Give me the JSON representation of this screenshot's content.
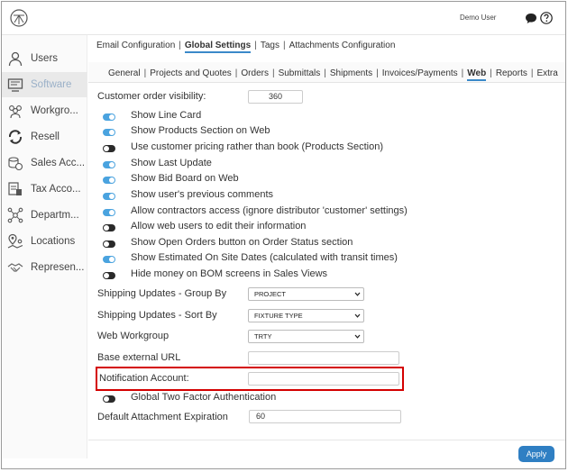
{
  "header": {
    "user_name": "Demo User"
  },
  "sidebar": {
    "items": [
      {
        "label": "Users",
        "icon": "user-icon"
      },
      {
        "label": "Software",
        "icon": "monitor-icon",
        "active": true
      },
      {
        "label": "Workgro...",
        "icon": "people-icon"
      },
      {
        "label": "Resell",
        "icon": "refresh-icon"
      },
      {
        "label": "Sales Acc...",
        "icon": "coins-icon"
      },
      {
        "label": "Tax Acco...",
        "icon": "tax-document-icon"
      },
      {
        "label": "Departm...",
        "icon": "network-icon"
      },
      {
        "label": "Locations",
        "icon": "map-pin-icon"
      },
      {
        "label": "Represen...",
        "icon": "handshake-icon"
      }
    ]
  },
  "main_tabs": [
    "Email Configuration",
    "Global Settings",
    "Tags",
    "Attachments Configuration"
  ],
  "main_tabs_active": "Global Settings",
  "sub_tabs": [
    "General",
    "Projects and Quotes",
    "Orders",
    "Submittals",
    "Shipments",
    "Invoices/Payments",
    "Web",
    "Reports",
    "Extra"
  ],
  "sub_tabs_active": "Web",
  "form": {
    "customer_order_visibility": {
      "label": "Customer order visibility:",
      "value": "360"
    },
    "toggles": [
      {
        "label": "Show Line Card",
        "on": true
      },
      {
        "label": "Show Products Section on Web",
        "on": true
      },
      {
        "label": "Use customer pricing rather than book (Products Section)",
        "on": false
      },
      {
        "label": "Show Last Update",
        "on": true
      },
      {
        "label": "Show Bid Board on Web",
        "on": true
      },
      {
        "label": "Show user's previous comments",
        "on": true
      },
      {
        "label": "Allow contractors access (ignore distributor 'customer' settings)",
        "on": true
      },
      {
        "label": "Allow web users to edit their information",
        "on": false
      },
      {
        "label": "Show Open Orders button on Order Status section",
        "on": false
      },
      {
        "label": "Show Estimated On Site Dates (calculated with transit times)",
        "on": true
      },
      {
        "label": "Hide money on BOM screens in Sales Views",
        "on": false
      }
    ],
    "shipping_group_by": {
      "label": "Shipping Updates - Group By",
      "value": "PROJECT"
    },
    "shipping_sort_by": {
      "label": "Shipping Updates - Sort By",
      "value": "FIXTURE TYPE"
    },
    "web_workgroup": {
      "label": "Web Workgroup",
      "value": "TRTY"
    },
    "base_external_url": {
      "label": "Base external URL",
      "value": ""
    },
    "notification_account": {
      "label": "Notification Account:",
      "value": ""
    },
    "two_factor": {
      "label": "Global Two Factor Authentication",
      "on": false
    },
    "attachment_expiration": {
      "label": "Default Attachment Expiration",
      "value": "60"
    }
  },
  "footer": {
    "apply_label": "Apply"
  },
  "colors": {
    "accent": "#2f7fc3",
    "toggle_on": "#4aa3df",
    "toggle_off": "#2a2a2a",
    "highlight": "#d40000"
  }
}
